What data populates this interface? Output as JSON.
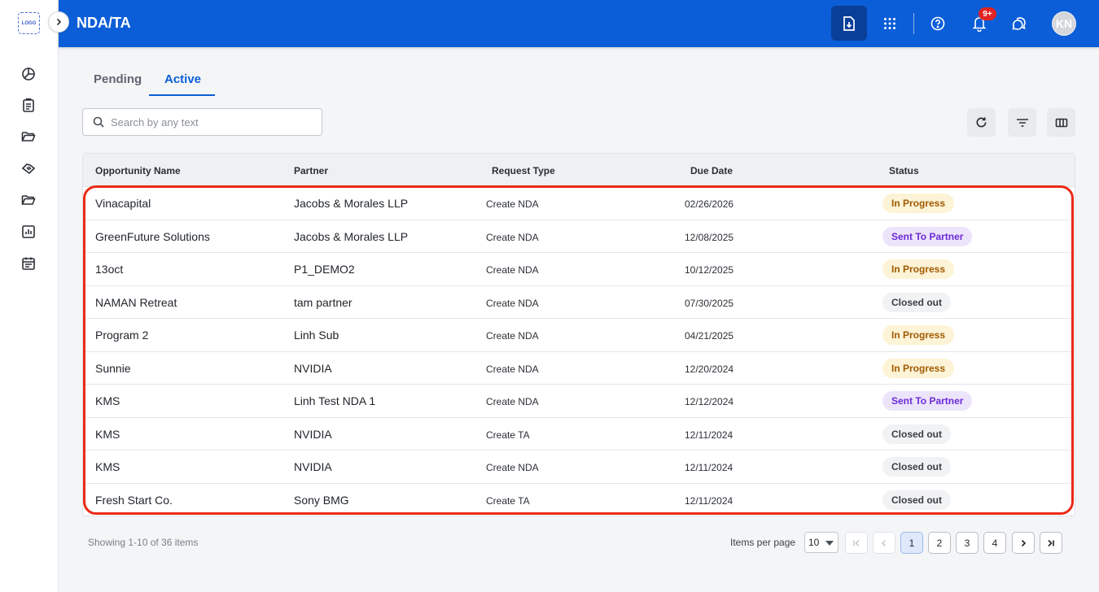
{
  "app": {
    "logo_text": "LOGO",
    "page_title": "NDA/TA",
    "notification_count": "9+",
    "user_initials": "KN"
  },
  "tabs": [
    {
      "label": "Pending",
      "active": false
    },
    {
      "label": "Active",
      "active": true
    }
  ],
  "search": {
    "placeholder": "Search by any text",
    "value": ""
  },
  "table": {
    "columns": [
      "Opportunity Name",
      "Partner",
      "Request Type",
      "Due Date",
      "Status"
    ],
    "rows": [
      {
        "opportunity": "Vinacapital",
        "partner": "Jacobs & Morales LLP",
        "request_type": "Create NDA",
        "due_date": "02/26/2026",
        "status": "In Progress"
      },
      {
        "opportunity": "GreenFuture Solutions",
        "partner": "Jacobs & Morales LLP",
        "request_type": "Create NDA",
        "due_date": "12/08/2025",
        "status": "Sent To Partner"
      },
      {
        "opportunity": "13oct",
        "partner": "P1_DEMO2",
        "request_type": "Create NDA",
        "due_date": "10/12/2025",
        "status": "In Progress"
      },
      {
        "opportunity": "NAMAN Retreat",
        "partner": "tam partner",
        "request_type": "Create NDA",
        "due_date": "07/30/2025",
        "status": "Closed out"
      },
      {
        "opportunity": "Program 2",
        "partner": "Linh Sub",
        "request_type": "Create NDA",
        "due_date": "04/21/2025",
        "status": "In Progress"
      },
      {
        "opportunity": "Sunnie",
        "partner": "NVIDIA",
        "request_type": "Create NDA",
        "due_date": "12/20/2024",
        "status": "In Progress"
      },
      {
        "opportunity": "KMS",
        "partner": "Linh Test NDA 1",
        "request_type": "Create NDA",
        "due_date": "12/12/2024",
        "status": "Sent To Partner"
      },
      {
        "opportunity": "KMS",
        "partner": "NVIDIA",
        "request_type": "Create TA",
        "due_date": "12/11/2024",
        "status": "Closed out"
      },
      {
        "opportunity": "KMS",
        "partner": "NVIDIA",
        "request_type": "Create NDA",
        "due_date": "12/11/2024",
        "status": "Closed out"
      },
      {
        "opportunity": "Fresh Start Co.",
        "partner": "Sony BMG",
        "request_type": "Create TA",
        "due_date": "12/11/2024",
        "status": "Closed out"
      }
    ]
  },
  "status_colors": {
    "In Progress": {
      "bg": "#fdf3d6",
      "fg": "#a05a00"
    },
    "Sent To Partner": {
      "bg": "#ece4fb",
      "fg": "#6b2bd6"
    },
    "Closed out": {
      "bg": "#f1f2f4",
      "fg": "#3a3f47"
    }
  },
  "pagination": {
    "showing_text": "Showing 1-10 of 36 items",
    "items_per_page_label": "Items per page",
    "items_per_page": "10",
    "pages": [
      "1",
      "2",
      "3",
      "4"
    ],
    "current_page": "1"
  },
  "colors": {
    "header_blue": "#0b5ed7",
    "highlight_red": "#ec2a17"
  }
}
